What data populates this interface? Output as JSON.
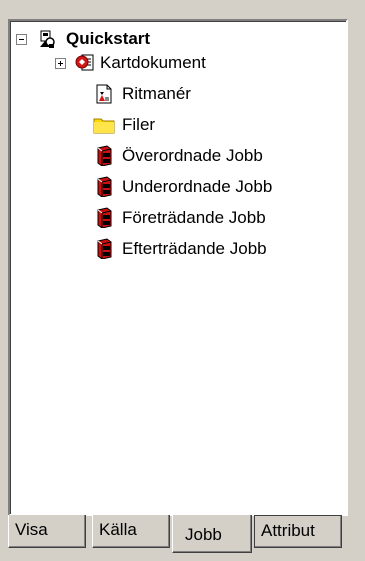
{
  "tree": {
    "root": {
      "label": "Quickstart",
      "icon": "connection-icon",
      "expanded": true
    },
    "items": [
      {
        "label": "Kartdokument",
        "icon": "map-document-icon",
        "expandable": true
      },
      {
        "label": "Ritmanér",
        "icon": "style-file-icon",
        "expandable": false
      },
      {
        "label": "Filer",
        "icon": "folder-icon",
        "expandable": false
      },
      {
        "label": "Överordnade Jobb",
        "icon": "job-book-icon",
        "expandable": false
      },
      {
        "label": "Underordnade Jobb",
        "icon": "job-book-icon",
        "expandable": false
      },
      {
        "label": "Företrädande Jobb",
        "icon": "job-book-icon",
        "expandable": false
      },
      {
        "label": "Efterträdande Jobb",
        "icon": "job-book-icon",
        "expandable": false
      }
    ]
  },
  "tabs": [
    {
      "label": "Visa",
      "active": false
    },
    {
      "label": "Källa",
      "active": false
    },
    {
      "label": "Jobb",
      "active": true
    },
    {
      "label": "Attribut",
      "active": false
    }
  ],
  "colors": {
    "background": "#d4d0c8",
    "panel": "#ffffff",
    "folder": "#ffd800",
    "job_red": "#cc1010"
  }
}
